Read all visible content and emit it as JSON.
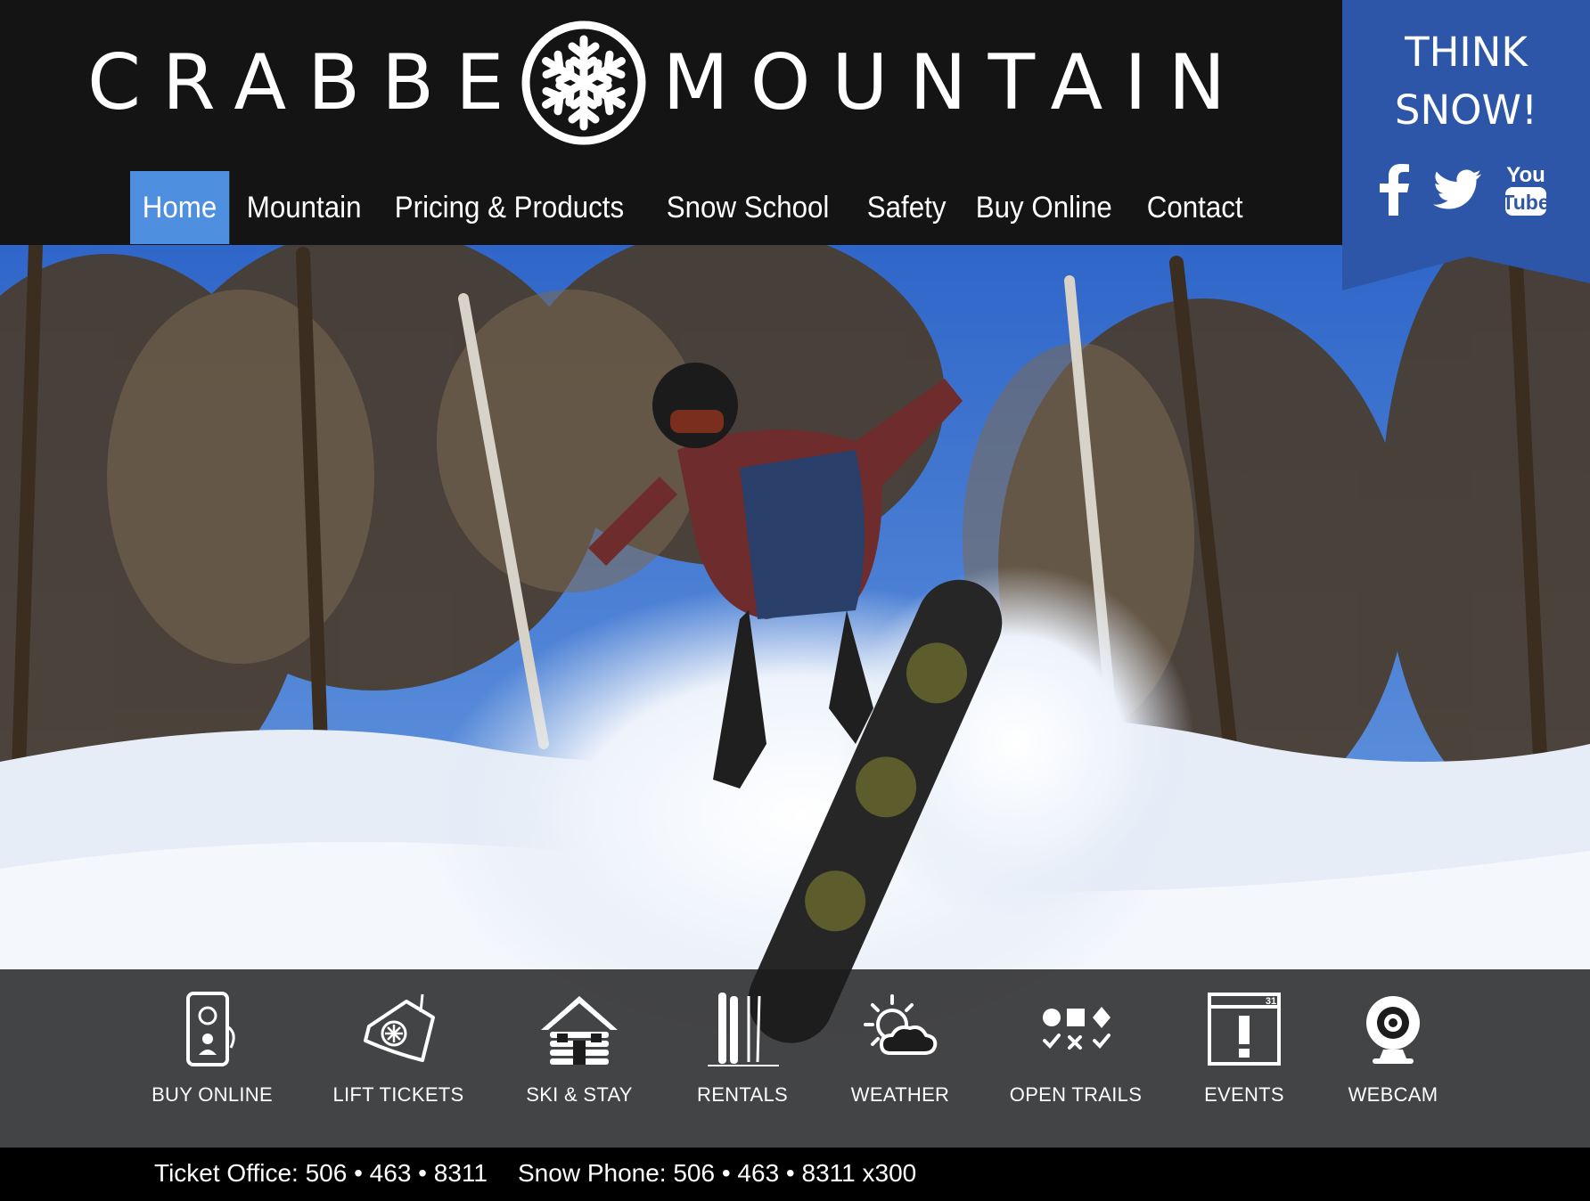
{
  "brand": {
    "name_left": "CRABBE",
    "name_right": "MOUNTAIN",
    "logo_icon": "snowflake-icon"
  },
  "nav": {
    "items": [
      {
        "label": "Home",
        "active": true
      },
      {
        "label": "Mountain"
      },
      {
        "label": "Pricing & Products"
      },
      {
        "label": "Snow School"
      },
      {
        "label": "Safety"
      },
      {
        "label": "Buy Online"
      },
      {
        "label": "Contact"
      }
    ]
  },
  "banner": {
    "line1": "THINK",
    "line2": "SNOW!",
    "social": [
      {
        "icon": "facebook-icon"
      },
      {
        "icon": "twitter-icon"
      },
      {
        "icon": "youtube-icon",
        "text_top": "You",
        "text_bottom": "Tube"
      }
    ]
  },
  "quicklinks": [
    {
      "label": "BUY ONLINE",
      "icon": "mobile-phone-icon"
    },
    {
      "label": "LIFT TICKETS",
      "icon": "lift-ticket-icon"
    },
    {
      "label": "SKI & STAY",
      "icon": "log-cabin-icon"
    },
    {
      "label": "RENTALS",
      "icon": "skis-icon"
    },
    {
      "label": "WEATHER",
      "icon": "sun-cloud-icon"
    },
    {
      "label": "OPEN TRAILS",
      "icon": "trail-difficulty-icon"
    },
    {
      "label": "EVENTS",
      "icon": "calendar-icon",
      "day": "31"
    },
    {
      "label": "WEBCAM",
      "icon": "webcam-icon"
    }
  ],
  "footer": {
    "ticket_office": "Ticket Office: 506 • 463 • 8311",
    "snow_phone": "Snow Phone: 506 • 463 • 8311 x300"
  },
  "colors": {
    "header_bg": "#141414",
    "nav_active": "#4f8fe0",
    "banner_blue": "#2d56a8",
    "footer_bg": "#000000"
  }
}
